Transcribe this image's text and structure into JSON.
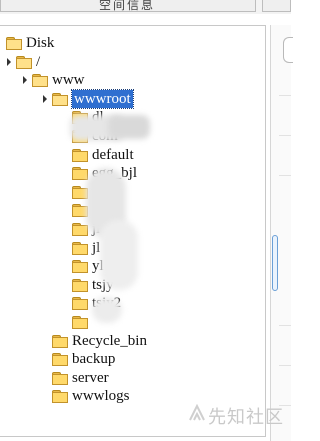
{
  "top_button_label": "空间信息",
  "tree": [
    {
      "label": "Disk",
      "depth": 0,
      "expander": false,
      "open": true
    },
    {
      "label": "/",
      "depth": 1,
      "expander": true,
      "open": true
    },
    {
      "label": "www",
      "depth": 2,
      "expander": true,
      "open": true
    },
    {
      "label": "wwwroot",
      "depth": 3,
      "expander": true,
      "open": true,
      "selected": true
    },
    {
      "label": "dl",
      "depth": 4,
      "expander": false,
      "open": false
    },
    {
      "label": "com",
      "depth": 4,
      "expander": false,
      "open": false
    },
    {
      "label": "default",
      "depth": 4,
      "expander": false,
      "open": false
    },
    {
      "label": "egg_bjl",
      "depth": 4,
      "expander": false,
      "open": false
    },
    {
      "label": "g_yl",
      "depth": 4,
      "expander": false,
      "open": false
    },
    {
      "label": "c",
      "depth": 4,
      "expander": false,
      "open": false
    },
    {
      "label": "ji",
      "depth": 4,
      "expander": false,
      "open": false
    },
    {
      "label": "jl",
      "depth": 4,
      "expander": false,
      "open": false
    },
    {
      "label": "yl",
      "depth": 4,
      "expander": false,
      "open": false
    },
    {
      "label": "tsjy",
      "depth": 4,
      "expander": false,
      "open": false
    },
    {
      "label": "tsjy2",
      "depth": 4,
      "expander": false,
      "open": false
    },
    {
      "label": "",
      "depth": 4,
      "expander": false,
      "open": false
    },
    {
      "label": "Recycle_bin",
      "depth": 3,
      "expander": false,
      "open": false
    },
    {
      "label": "backup",
      "depth": 3,
      "expander": false,
      "open": false
    },
    {
      "label": "server",
      "depth": 3,
      "expander": false,
      "open": false
    },
    {
      "label": "wwwlogs",
      "depth": 3,
      "expander": false,
      "open": false
    }
  ],
  "watermark": "先知社区"
}
